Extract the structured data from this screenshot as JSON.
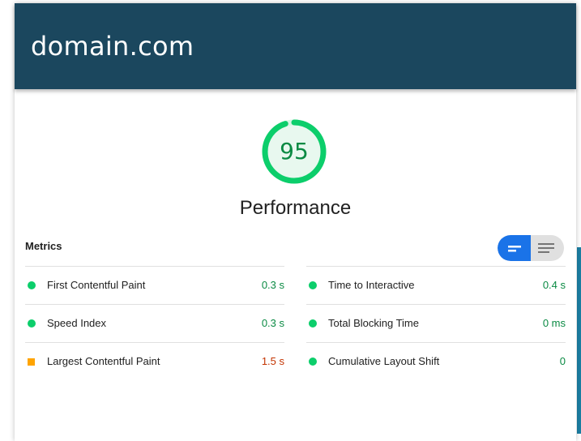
{
  "header": {
    "title": "domain.com",
    "background_color": "#1b475e"
  },
  "score": {
    "value": "95",
    "fraction": 0.95,
    "label": "Performance",
    "color": "#0cce6b"
  },
  "metrics": {
    "title": "Metrics",
    "view_toggle": {
      "active": "compact-view-icon",
      "inactive": "expanded-view-icon",
      "accent_color": "#1a73e8"
    },
    "left": [
      {
        "label": "First Contentful Paint",
        "value": "0.3 s",
        "status": "pass"
      },
      {
        "label": "Speed Index",
        "value": "0.3 s",
        "status": "pass"
      },
      {
        "label": "Largest Contentful Paint",
        "value": "1.5 s",
        "status": "average"
      }
    ],
    "right": [
      {
        "label": "Time to Interactive",
        "value": "0.4 s",
        "status": "pass"
      },
      {
        "label": "Total Blocking Time",
        "value": "0 ms",
        "status": "pass"
      },
      {
        "label": "Cumulative Layout Shift",
        "value": "0",
        "status": "pass"
      }
    ]
  },
  "colors": {
    "pass": "#0cce6b",
    "pass_text": "#0a8a43",
    "average": "#ffa400",
    "average_text": "#c33300"
  }
}
